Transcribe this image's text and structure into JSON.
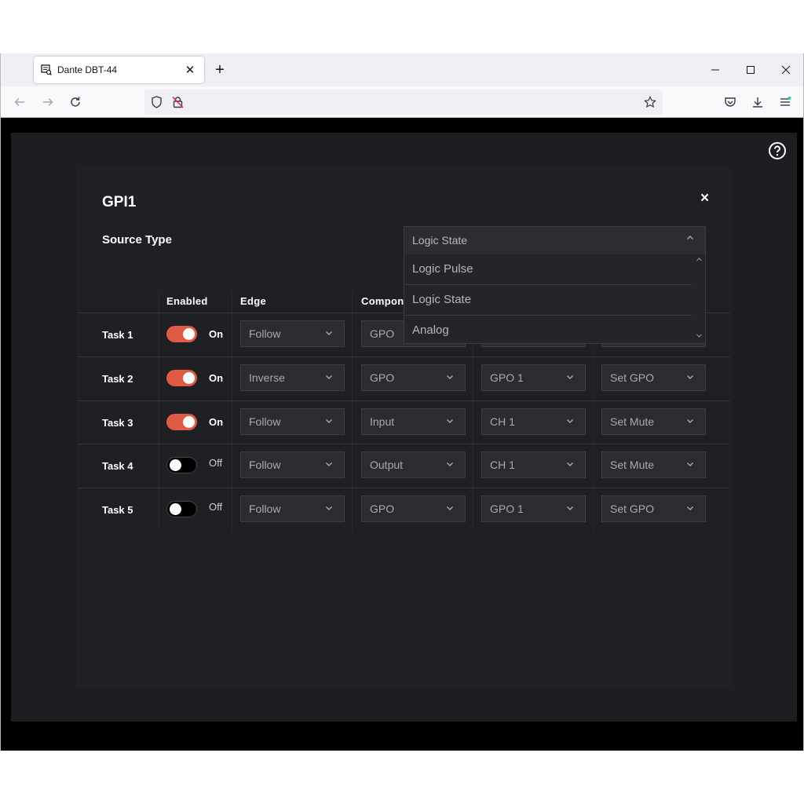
{
  "browser": {
    "tab_title": "Dante DBT-44",
    "tab_close": "✕",
    "new_tab": "+",
    "win_min": "—",
    "win_max": "☐",
    "win_close": "✕"
  },
  "modal": {
    "title": "GPI1",
    "close": "×",
    "source_type_label": "Source Type",
    "source_type_value": "Logic State",
    "source_type_options": [
      "Logic Pulse",
      "Logic State",
      "Analog"
    ]
  },
  "table": {
    "headers": {
      "enabled": "Enabled",
      "edge": "Edge",
      "component": "Compon"
    },
    "rows": [
      {
        "task": "Task 1",
        "enabled": true,
        "state_label": "On",
        "edge": "Follow",
        "component": "GPO",
        "channel": "",
        "action": ""
      },
      {
        "task": "Task 2",
        "enabled": true,
        "state_label": "On",
        "edge": "Inverse",
        "component": "GPO",
        "channel": "GPO 1",
        "action": "Set GPO"
      },
      {
        "task": "Task 3",
        "enabled": true,
        "state_label": "On",
        "edge": "Follow",
        "component": "Input",
        "channel": "CH 1",
        "action": "Set Mute"
      },
      {
        "task": "Task 4",
        "enabled": false,
        "state_label": "Off",
        "edge": "Follow",
        "component": "Output",
        "channel": "CH 1",
        "action": "Set Mute"
      },
      {
        "task": "Task 5",
        "enabled": false,
        "state_label": "Off",
        "edge": "Follow",
        "component": "GPO",
        "channel": "GPO 1",
        "action": "Set GPO"
      }
    ]
  },
  "colors": {
    "toggle_on": "#e05a45",
    "modal_bg": "#1f2024",
    "select_bg": "#2b2c31"
  }
}
